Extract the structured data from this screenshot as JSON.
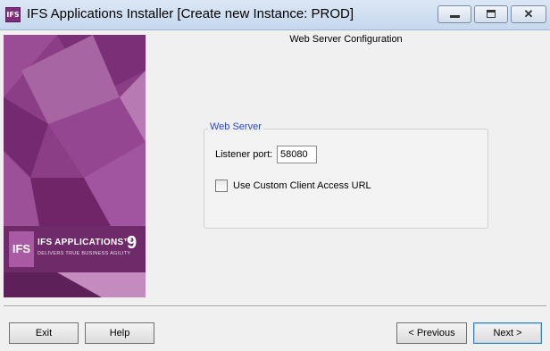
{
  "window": {
    "icon_text": "IFS",
    "title": "IFS Applications Installer  [Create new Instance: PROD]",
    "minimize_glyph": "",
    "close_glyph": "✕"
  },
  "banner": {
    "logo_box_text": "IFS",
    "product_name": "IFS APPLICATIONS™",
    "version": "9",
    "tagline": "DELIVERS TRUE BUSINESS AGILITY"
  },
  "page": {
    "heading": "Web Server Configuration"
  },
  "web_server": {
    "group_title": "Web Server",
    "listener_port_label": "Listener port:",
    "listener_port_value": "58080",
    "custom_url_label": "Use Custom Client Access URL",
    "custom_url_checked": false
  },
  "buttons": {
    "exit": "Exit",
    "help": "Help",
    "previous": "< Previous",
    "next": "Next >"
  },
  "colors": {
    "banner_purple": "#8b3d86",
    "group_title_blue": "#2a47c8",
    "titlebar_blue": "#c6d8ee"
  }
}
